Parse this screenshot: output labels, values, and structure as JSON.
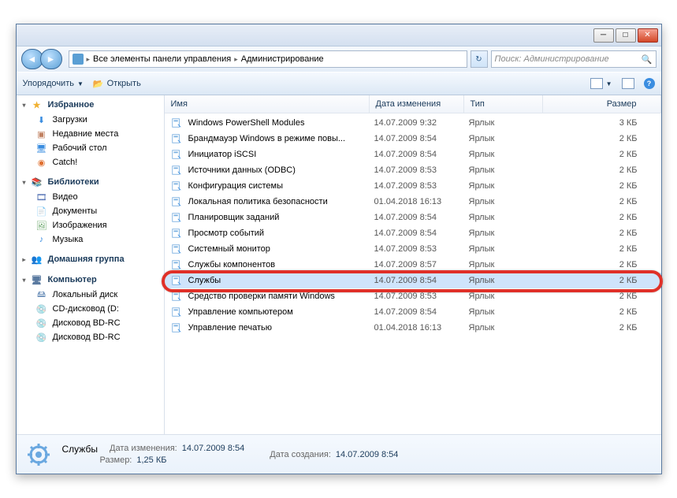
{
  "breadcrumb": {
    "item1": "Все элементы панели управления",
    "item2": "Администрирование"
  },
  "search": {
    "placeholder": "Поиск: Администрирование"
  },
  "toolbar": {
    "organize": "Упорядочить",
    "open": "Открыть"
  },
  "sidebar": {
    "favorites": {
      "header": "Избранное",
      "items": [
        "Загрузки",
        "Недавние места",
        "Рабочий стол",
        "Catch!"
      ]
    },
    "libraries": {
      "header": "Библиотеки",
      "items": [
        "Видео",
        "Документы",
        "Изображения",
        "Музыка"
      ]
    },
    "homegroup": {
      "header": "Домашняя группа"
    },
    "computer": {
      "header": "Компьютер",
      "items": [
        "Локальный диск",
        "CD-дисковод (D:",
        "Дисковод BD-RC",
        "Дисковод BD-RC"
      ]
    }
  },
  "columns": {
    "name": "Имя",
    "date": "Дата изменения",
    "type": "Тип",
    "size": "Размер"
  },
  "files": [
    {
      "name": "Windows PowerShell Modules",
      "date": "14.07.2009 9:32",
      "type": "Ярлык",
      "size": "3 КБ"
    },
    {
      "name": "Брандмауэр Windows в режиме повы...",
      "date": "14.07.2009 8:54",
      "type": "Ярлык",
      "size": "2 КБ"
    },
    {
      "name": "Инициатор iSCSI",
      "date": "14.07.2009 8:54",
      "type": "Ярлык",
      "size": "2 КБ"
    },
    {
      "name": "Источники данных (ODBC)",
      "date": "14.07.2009 8:53",
      "type": "Ярлык",
      "size": "2 КБ"
    },
    {
      "name": "Конфигурация системы",
      "date": "14.07.2009 8:53",
      "type": "Ярлык",
      "size": "2 КБ"
    },
    {
      "name": "Локальная политика безопасности",
      "date": "01.04.2018 16:13",
      "type": "Ярлык",
      "size": "2 КБ"
    },
    {
      "name": "Планировщик заданий",
      "date": "14.07.2009 8:54",
      "type": "Ярлык",
      "size": "2 КБ"
    },
    {
      "name": "Просмотр событий",
      "date": "14.07.2009 8:54",
      "type": "Ярлык",
      "size": "2 КБ"
    },
    {
      "name": "Системный монитор",
      "date": "14.07.2009 8:53",
      "type": "Ярлык",
      "size": "2 КБ"
    },
    {
      "name": "Службы компонентов",
      "date": "14.07.2009 8:57",
      "type": "Ярлык",
      "size": "2 КБ"
    },
    {
      "name": "Службы",
      "date": "14.07.2009 8:54",
      "type": "Ярлык",
      "size": "2 КБ"
    },
    {
      "name": "Средство проверки памяти Windows",
      "date": "14.07.2009 8:53",
      "type": "Ярлык",
      "size": "2 КБ"
    },
    {
      "name": "Управление компьютером",
      "date": "14.07.2009 8:54",
      "type": "Ярлык",
      "size": "2 КБ"
    },
    {
      "name": "Управление печатью",
      "date": "01.04.2018 16:13",
      "type": "Ярлык",
      "size": "2 КБ"
    }
  ],
  "details": {
    "title": "Службы",
    "mod_label": "Дата изменения:",
    "mod_value": "14.07.2009 8:54",
    "size_label": "Размер:",
    "size_value": "1,25 КБ",
    "created_label": "Дата создания:",
    "created_value": "14.07.2009 8:54"
  }
}
